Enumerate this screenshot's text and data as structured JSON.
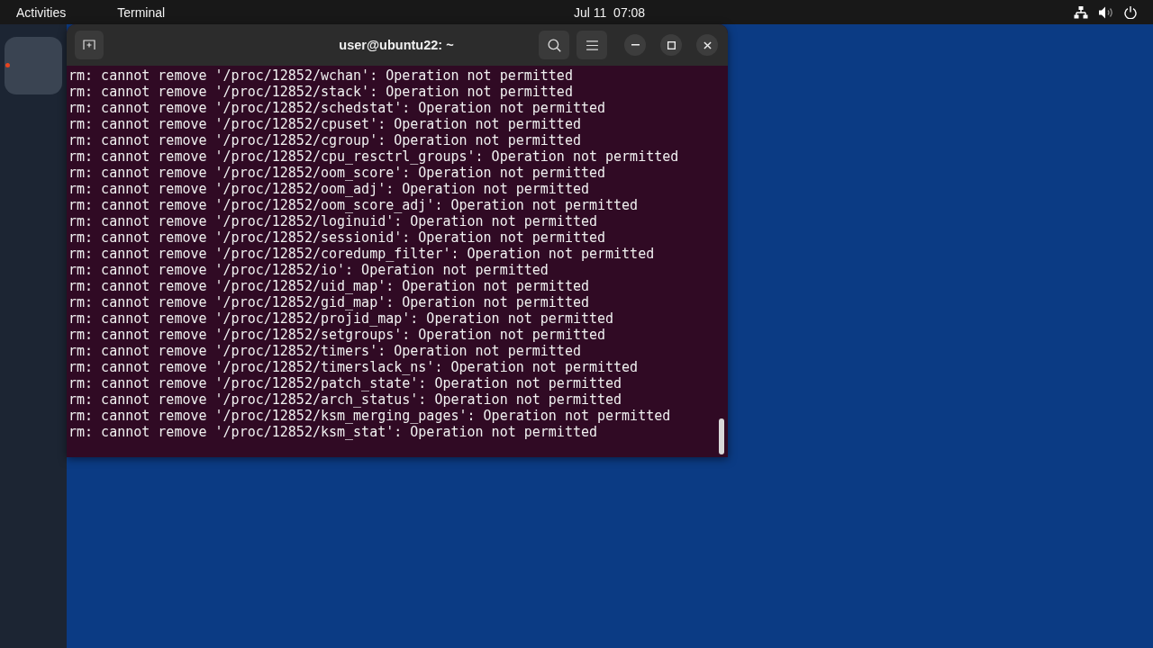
{
  "top_bar": {
    "activities": "Activities",
    "app_menu": "Terminal",
    "clock": "Jul 11  07:08"
  },
  "dock": {
    "items": [
      {
        "running": true
      }
    ]
  },
  "terminal": {
    "title": "user@ubuntu22: ~",
    "lines": [
      "rm: cannot remove '/proc/12852/wchan': Operation not permitted",
      "rm: cannot remove '/proc/12852/stack': Operation not permitted",
      "rm: cannot remove '/proc/12852/schedstat': Operation not permitted",
      "rm: cannot remove '/proc/12852/cpuset': Operation not permitted",
      "rm: cannot remove '/proc/12852/cgroup': Operation not permitted",
      "rm: cannot remove '/proc/12852/cpu_resctrl_groups': Operation not permitted",
      "rm: cannot remove '/proc/12852/oom_score': Operation not permitted",
      "rm: cannot remove '/proc/12852/oom_adj': Operation not permitted",
      "rm: cannot remove '/proc/12852/oom_score_adj': Operation not permitted",
      "rm: cannot remove '/proc/12852/loginuid': Operation not permitted",
      "rm: cannot remove '/proc/12852/sessionid': Operation not permitted",
      "rm: cannot remove '/proc/12852/coredump_filter': Operation not permitted",
      "rm: cannot remove '/proc/12852/io': Operation not permitted",
      "rm: cannot remove '/proc/12852/uid_map': Operation not permitted",
      "rm: cannot remove '/proc/12852/gid_map': Operation not permitted",
      "rm: cannot remove '/proc/12852/projid_map': Operation not permitted",
      "rm: cannot remove '/proc/12852/setgroups': Operation not permitted",
      "rm: cannot remove '/proc/12852/timers': Operation not permitted",
      "rm: cannot remove '/proc/12852/timerslack_ns': Operation not permitted",
      "rm: cannot remove '/proc/12852/patch_state': Operation not permitted",
      "rm: cannot remove '/proc/12852/arch_status': Operation not permitted",
      "rm: cannot remove '/proc/12852/ksm_merging_pages': Operation not permitted",
      "rm: cannot remove '/proc/12852/ksm_stat': Operation not permitted"
    ]
  }
}
